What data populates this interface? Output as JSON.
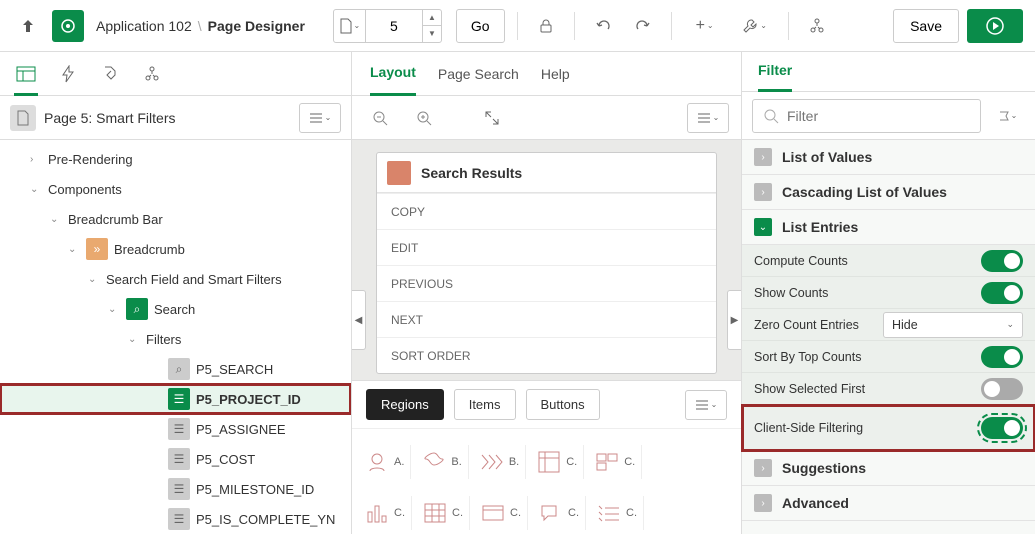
{
  "breadcrumb": {
    "app": "Application 102",
    "page": "Page Designer"
  },
  "page_input": {
    "value": "5",
    "go": "Go"
  },
  "toolbar": {
    "save": "Save"
  },
  "left": {
    "page_title": "Page 5: Smart Filters",
    "tree": {
      "pre_rendering": "Pre-Rendering",
      "components": "Components",
      "breadcrumb_bar": "Breadcrumb Bar",
      "breadcrumb": "Breadcrumb",
      "search_field": "Search Field and Smart Filters",
      "search": "Search",
      "filters": "Filters",
      "items": [
        "P5_SEARCH",
        "P5_PROJECT_ID",
        "P5_ASSIGNEE",
        "P5_COST",
        "P5_MILESTONE_ID",
        "P5_IS_COMPLETE_YN"
      ]
    }
  },
  "center": {
    "tabs": {
      "layout": "Layout",
      "page_search": "Page Search",
      "help": "Help"
    },
    "region": {
      "title": "Search Results",
      "items": [
        "COPY",
        "EDIT",
        "PREVIOUS",
        "NEXT",
        "SORT ORDER"
      ]
    },
    "comp_tabs": {
      "regions": "Regions",
      "items": "Items",
      "buttons": "Buttons"
    },
    "gallery_labels": [
      "A.",
      "B.",
      "B.",
      "C.",
      "C.",
      "C.",
      "C.",
      "C.",
      "C.",
      "C."
    ]
  },
  "right": {
    "tab": "Filter",
    "filter_placeholder": "Filter",
    "sections": {
      "lov": "List of Values",
      "cascading": "Cascading List of Values",
      "entries": "List Entries",
      "suggestions": "Suggestions",
      "advanced": "Advanced"
    },
    "entries": {
      "compute_counts": "Compute Counts",
      "show_counts": "Show Counts",
      "zero_count": "Zero Count Entries",
      "zero_count_value": "Hide",
      "sort_top": "Sort By Top Counts",
      "show_selected": "Show Selected First",
      "client_side": "Client-Side Filtering"
    },
    "toggles": {
      "compute_counts": true,
      "show_counts": true,
      "sort_top": true,
      "show_selected": false,
      "client_side": true
    }
  }
}
